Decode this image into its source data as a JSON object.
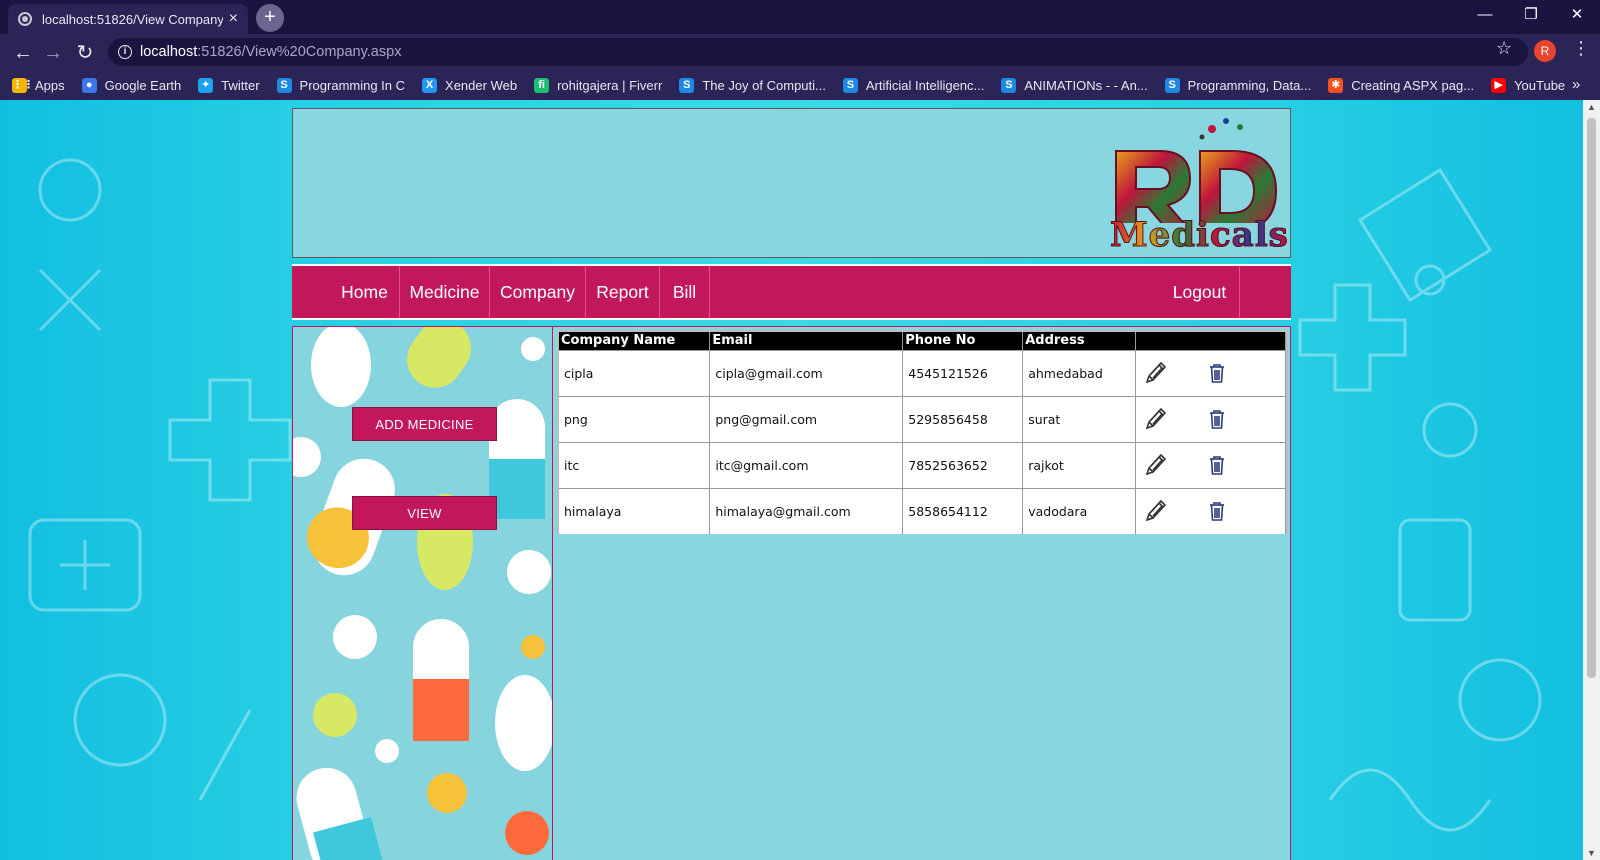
{
  "browser": {
    "tab_title": "localhost:51826/View Company.a",
    "tab_close": "×",
    "new_tab": "+",
    "url_host": "localhost",
    "url_path": ":51826/View%20Company.aspx",
    "profile_initial": "R",
    "bookmarks": [
      {
        "label": "Apps",
        "icon": "apps-grid-icon",
        "color": "#f4b400"
      },
      {
        "label": "Google Earth",
        "icon": "google-earth-icon",
        "color": "#3b78e7"
      },
      {
        "label": "Twitter",
        "icon": "twitter-icon",
        "color": "#1da1f2"
      },
      {
        "label": "Programming In C",
        "icon": "site-s-icon",
        "color": "#1e88e5"
      },
      {
        "label": "Xender Web",
        "icon": "xender-icon",
        "color": "#2196f3"
      },
      {
        "label": "rohitgajera | Fiverr",
        "icon": "fiverr-icon",
        "color": "#1dbf73"
      },
      {
        "label": "The Joy of Computi...",
        "icon": "site-s-icon",
        "color": "#1e88e5"
      },
      {
        "label": "Artificial Intelligenc...",
        "icon": "site-s-icon",
        "color": "#1e88e5"
      },
      {
        "label": "ANIMATIONs - - An...",
        "icon": "site-s-icon",
        "color": "#1e88e5"
      },
      {
        "label": "Programming, Data...",
        "icon": "site-s-icon",
        "color": "#1e88e5"
      },
      {
        "label": "Creating ASPX pag...",
        "icon": "aspx-icon",
        "color": "#f4511e"
      },
      {
        "label": "YouTube",
        "icon": "youtube-icon",
        "color": "#ff0000"
      }
    ],
    "bookmarks_more": "»"
  },
  "site": {
    "logo_text": "Medicals",
    "nav": [
      {
        "label": "Home"
      },
      {
        "label": "Medicine"
      },
      {
        "label": "Company"
      },
      {
        "label": "Report"
      },
      {
        "label": "Bill"
      }
    ],
    "logout_label": "Logout",
    "sidebar": {
      "add_medicine_label": "ADD MEDICINE",
      "view_label": "VIEW"
    },
    "table": {
      "columns": [
        "Company Name",
        "Email",
        "Phone No",
        "Address",
        ""
      ],
      "rows": [
        [
          "cipla",
          "cipla@gmail.com",
          "4545121526",
          "ahmedabad"
        ],
        [
          "png",
          "png@gmail.com",
          "5295856458",
          "surat"
        ],
        [
          "itc",
          "itc@gmail.com",
          "7852563652",
          "rajkot"
        ],
        [
          "himalaya",
          "himalaya@gmail.com",
          "5858654112",
          "vadodara"
        ]
      ]
    }
  },
  "colors": {
    "brand": "#c2185b",
    "panel": "#88d6df",
    "chrome": "#2b2456"
  }
}
